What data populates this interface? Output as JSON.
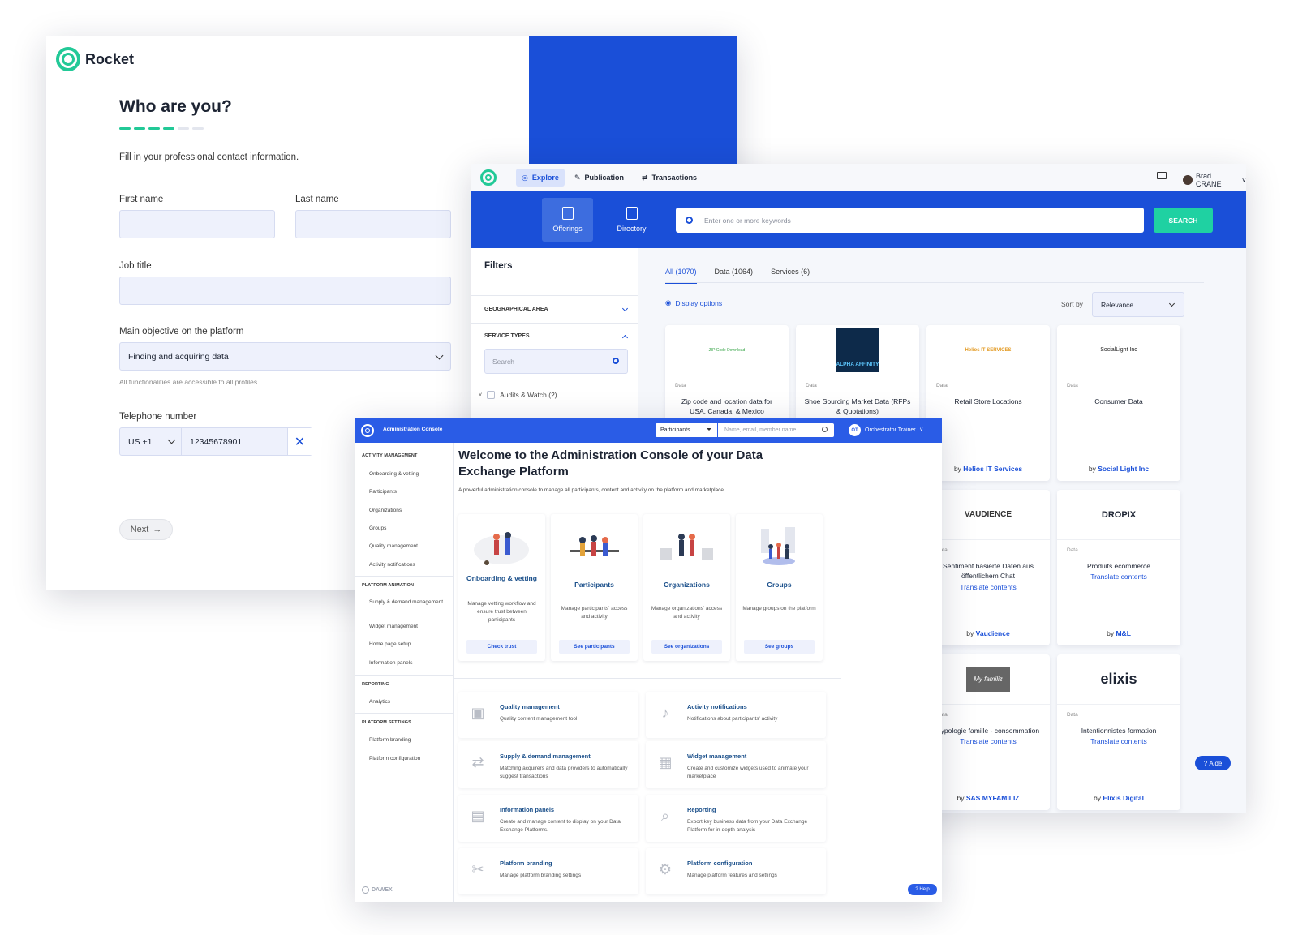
{
  "rocket": {
    "brand": "Rocket",
    "title": "Who are you?",
    "lead": "Fill in your professional contact information.",
    "first_name_label": "First name",
    "last_name_label": "Last name",
    "job_title_label": "Job title",
    "objective_label": "Main objective on the platform",
    "objective_value": "Finding and acquiring data",
    "objective_hint": "All functionalities are accessible to all profiles",
    "phone_label": "Telephone number",
    "country_code": "US +1",
    "phone_value": "12345678901",
    "next_label": "Next",
    "steps_done": 4,
    "steps_total": 6,
    "colors": {
      "accent": "#22c997",
      "blue": "#1a4fd8"
    }
  },
  "market": {
    "nav": [
      "Explore",
      "Publication",
      "Transactions"
    ],
    "user_name": "Brad CRANE",
    "hero_tabs": [
      "Offerings",
      "Directory"
    ],
    "search_placeholder": "Enter one or more keywords",
    "search_button": "SEARCH",
    "filters_title": "Filters",
    "filter_geo": "GEOGRAPHICAL AREA",
    "filter_service": "SERVICE TYPES",
    "filter_search_placeholder": "Search",
    "filter_item": "Audits & Watch (2)",
    "tabs": [
      "All (1070)",
      "Data (1064)",
      "Services (6)"
    ],
    "display_options": "Display options",
    "sort_label": "Sort by",
    "sort_value": "Relevance",
    "aide": "Aide",
    "cards": [
      {
        "logo": "ZIP Code Download",
        "type": "Data",
        "title": "Zip code and location data for USA, Canada, & Mexico",
        "translate": "",
        "by_prefix": "",
        "by": ""
      },
      {
        "logo": "ALPHA AFFINITY",
        "type": "Data",
        "title": "Shoe Sourcing Market Data (RFPs & Quotations)",
        "translate": "",
        "by_prefix": "",
        "by": ""
      },
      {
        "logo": "Helios IT SERVICES",
        "type": "Data",
        "title": "Retail Store Locations",
        "translate": "",
        "by_prefix": "by",
        "by": "Helios IT Services"
      },
      {
        "logo": "SocialLight Inc",
        "type": "Data",
        "title": "Consumer Data",
        "translate": "",
        "by_prefix": "by",
        "by": "Social Light Inc"
      },
      {
        "logo": "VAUDIENCE",
        "type": "Data",
        "title": "Sentiment basierte Daten aus öffentlichem Chat",
        "translate": "Translate contents",
        "by_prefix": "by",
        "by": "Vaudience"
      },
      {
        "logo": "DROPIX",
        "type": "Data",
        "title": "Produits ecommerce",
        "translate": "Translate contents",
        "by_prefix": "by",
        "by": "M&L"
      },
      {
        "logo": "My familiz",
        "type": "Data",
        "title": "Typologie famille - consommation",
        "translate": "Translate contents",
        "by_prefix": "by",
        "by": "SAS MYFAMILIZ"
      },
      {
        "logo": "elixis",
        "type": "Data",
        "title": "Intentionnistes formation",
        "translate": "Translate contents",
        "by_prefix": "by",
        "by": "Elixis Digital"
      }
    ]
  },
  "admin": {
    "app_name": "Administration Console",
    "scope_select": "Participants",
    "search_placeholder": "Name, email, member name...",
    "user_initials": "OT",
    "user_name": "Orchestrator Trainer",
    "sidebar": [
      {
        "heading": "ACTIVITY MANAGEMENT",
        "items": [
          "Onboarding & vetting",
          "Participants",
          "Organizations",
          "Groups",
          "Quality management",
          "Activity notifications"
        ]
      },
      {
        "heading": "PLATFORM ANIMATION",
        "items": [
          "Supply & demand management",
          "Widget management",
          "Home page setup",
          "Information panels"
        ]
      },
      {
        "heading": "REPORTING",
        "items": [
          "Analytics"
        ]
      },
      {
        "heading": "PLATFORM SETTINGS",
        "items": [
          "Platform branding",
          "Platform configuration"
        ]
      }
    ],
    "powered_by": "DAWEX",
    "title": "Welcome to the Administration Console of your Data Exchange Platform",
    "lead": "A powerful administration console to manage all participants, content and activity on the platform and marketplace.",
    "tiles": [
      {
        "title": "Onboarding & vetting",
        "desc": "Manage vetting workflow and ensure trust between participants",
        "button": "Check trust"
      },
      {
        "title": "Participants",
        "desc": "Manage participants' access and activity",
        "button": "See participants"
      },
      {
        "title": "Organizations",
        "desc": "Manage organizations' access and activity",
        "button": "See organizations"
      },
      {
        "title": "Groups",
        "desc": "Manage groups on the platform",
        "button": "See groups"
      }
    ],
    "rows": [
      {
        "icon": "alert-icon",
        "title": "Quality management",
        "desc": "Quality content management tool"
      },
      {
        "icon": "bell-icon",
        "title": "Activity notifications",
        "desc": "Notifications about participants' activity"
      },
      {
        "icon": "swap-icon",
        "title": "Supply & demand management",
        "desc": "Matching acquirers and data providers to automatically suggest transactions"
      },
      {
        "icon": "widgets-icon",
        "title": "Widget management",
        "desc": "Create and customize widgets used to animate your marketplace"
      },
      {
        "icon": "comment-icon",
        "title": "Information panels",
        "desc": "Create and manage content to display on your Data Exchange Platforms."
      },
      {
        "icon": "search-icon",
        "title": "Reporting",
        "desc": "Export key business data from your Data Exchange Platform for in-depth analysis"
      },
      {
        "icon": "tools-icon",
        "title": "Platform branding",
        "desc": "Manage platform branding settings"
      },
      {
        "icon": "gear-icon",
        "title": "Platform configuration",
        "desc": "Manage platform features and settings"
      }
    ],
    "help": "Help"
  }
}
